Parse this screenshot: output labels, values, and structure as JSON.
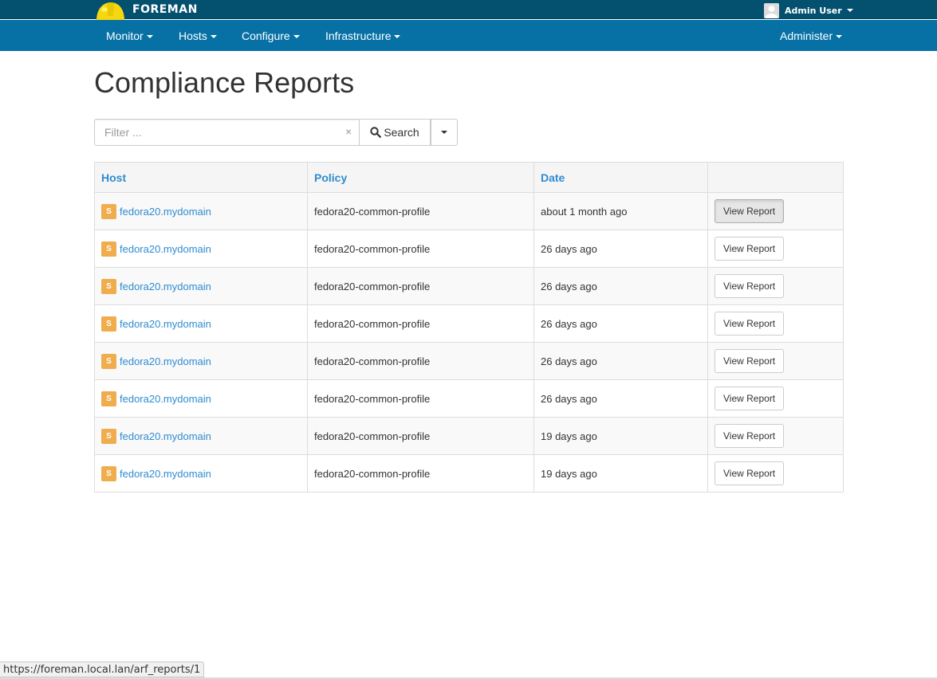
{
  "brand": {
    "name": "FOREMAN"
  },
  "user": {
    "name": "Admin User"
  },
  "nav": {
    "items": [
      {
        "label": "Monitor"
      },
      {
        "label": "Hosts"
      },
      {
        "label": "Configure"
      },
      {
        "label": "Infrastructure"
      }
    ],
    "right": {
      "label": "Administer"
    }
  },
  "page": {
    "title": "Compliance Reports"
  },
  "search": {
    "placeholder": "Filter ...",
    "clear_glyph": "×",
    "button_label": "Search"
  },
  "table": {
    "columns": [
      "Host",
      "Policy",
      "Date",
      ""
    ],
    "rows": [
      {
        "status": "S",
        "host": "fedora20.mydomain",
        "policy": "fedora20-common-profile",
        "date": "about 1 month ago",
        "action": "View Report"
      },
      {
        "status": "S",
        "host": "fedora20.mydomain",
        "policy": "fedora20-common-profile",
        "date": "26 days ago",
        "action": "View Report"
      },
      {
        "status": "S",
        "host": "fedora20.mydomain",
        "policy": "fedora20-common-profile",
        "date": "26 days ago",
        "action": "View Report"
      },
      {
        "status": "S",
        "host": "fedora20.mydomain",
        "policy": "fedora20-common-profile",
        "date": "26 days ago",
        "action": "View Report"
      },
      {
        "status": "S",
        "host": "fedora20.mydomain",
        "policy": "fedora20-common-profile",
        "date": "26 days ago",
        "action": "View Report"
      },
      {
        "status": "S",
        "host": "fedora20.mydomain",
        "policy": "fedora20-common-profile",
        "date": "26 days ago",
        "action": "View Report"
      },
      {
        "status": "S",
        "host": "fedora20.mydomain",
        "policy": "fedora20-common-profile",
        "date": "19 days ago",
        "action": "View Report"
      },
      {
        "status": "S",
        "host": "fedora20.mydomain",
        "policy": "fedora20-common-profile",
        "date": "19 days ago",
        "action": "View Report"
      }
    ]
  },
  "status_bar": {
    "url": "https://foreman.local.lan/arf_reports/1"
  },
  "colors": {
    "topbar": "#03506f",
    "navbar": "#0771a6",
    "link": "#2f8ccf",
    "status_warning": "#f0ad4e"
  },
  "icons": {
    "logo": "helmet-logo",
    "avatar": "user-avatar-icon",
    "search": "search-icon",
    "dropdown": "caret-down-icon"
  }
}
